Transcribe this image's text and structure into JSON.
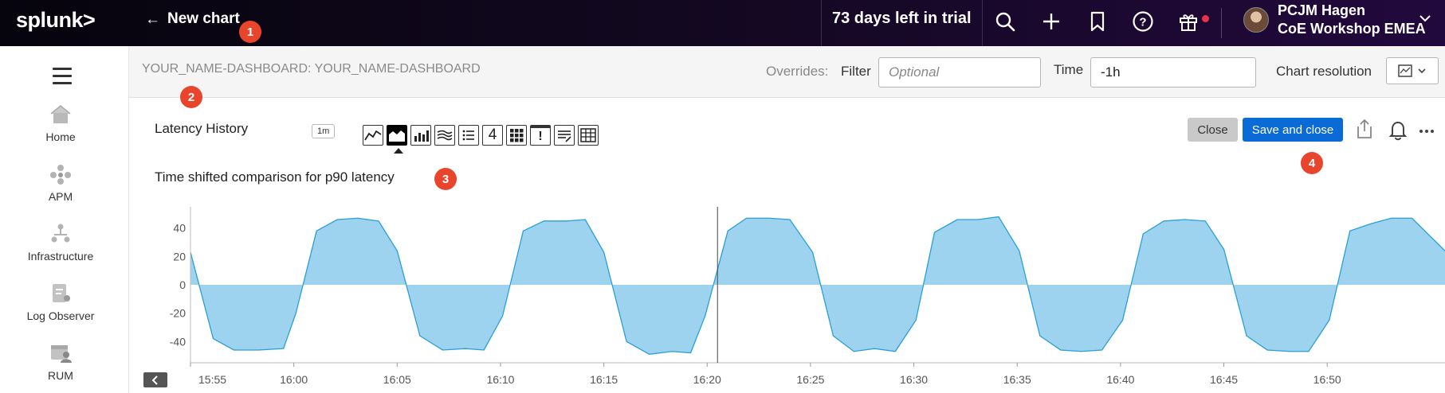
{
  "topbar": {
    "logo": "splunk>",
    "back_arrow": "←",
    "title": "New chart",
    "trial_text": "73 days left in trial",
    "icons": [
      "search-icon",
      "plus-icon",
      "bookmark-icon",
      "help-icon",
      "gift-icon"
    ],
    "user_name": "PCJM Hagen",
    "org_name": "CoE Workshop EMEA"
  },
  "sidebar": {
    "items": [
      {
        "label": "Home",
        "icon": "home-icon"
      },
      {
        "label": "APM",
        "icon": "apm-icon"
      },
      {
        "label": "Infrastructure",
        "icon": "infrastructure-icon"
      },
      {
        "label": "Log Observer",
        "icon": "log-observer-icon"
      },
      {
        "label": "RUM",
        "icon": "rum-icon"
      }
    ]
  },
  "header": {
    "breadcrumb": "YOUR_NAME-DASHBOARD: YOUR_NAME-DASHBOARD",
    "overrides_label": "Overrides:",
    "filter_label": "Filter",
    "filter_placeholder": "Optional",
    "time_label": "Time",
    "time_value": "-1h",
    "resolution_label": "Chart resolution"
  },
  "chart_header": {
    "title": "Latency History",
    "resolution_badge": "1m",
    "viz_types": [
      "line-chart-icon",
      "area-chart-icon",
      "column-chart-icon",
      "histogram-icon",
      "list-icon",
      "single-value-icon",
      "heatmap-icon",
      "event-feed-icon",
      "text-note-icon",
      "table-icon"
    ],
    "single_value_glyph": "4",
    "event_glyph": "!",
    "close_label": "Close",
    "save_label": "Save and close",
    "subtitle": "Time shifted comparison  for p90 latency"
  },
  "markers": [
    "1",
    "2",
    "3",
    "4"
  ],
  "colors": {
    "accent_blue": "#0a6ad6",
    "area_fill": "#9dd3ef",
    "area_stroke": "#2a9fd6",
    "marker_red": "#e8452c"
  },
  "chart_data": {
    "type": "area",
    "title": "",
    "xlabel": "",
    "ylabel": "",
    "ylim": [
      -55,
      55
    ],
    "y_ticks": [
      40,
      20,
      0,
      -20,
      -40
    ],
    "x_tick_labels": [
      "15:55",
      "16:00",
      "16:05",
      "16:10",
      "16:15",
      "16:20",
      "16:25",
      "16:30",
      "16:35",
      "16:40",
      "16:45",
      "16:50"
    ],
    "x_start_minute": 55,
    "x_end_minute": 115.7,
    "cursor_minute": 80.5,
    "grid": false,
    "series": [
      {
        "points": [
          [
            55.0,
            23
          ],
          [
            56.1,
            -38
          ],
          [
            57.1,
            -46
          ],
          [
            58.3,
            -46
          ],
          [
            59.5,
            -45
          ],
          [
            60.1,
            -20
          ],
          [
            61.1,
            38
          ],
          [
            62.1,
            46
          ],
          [
            63.1,
            47
          ],
          [
            64.1,
            45
          ],
          [
            65.0,
            24
          ],
          [
            66.1,
            -36
          ],
          [
            67.2,
            -46
          ],
          [
            68.3,
            -45
          ],
          [
            69.2,
            -46
          ],
          [
            70.1,
            -22
          ],
          [
            71.1,
            38
          ],
          [
            72.1,
            45
          ],
          [
            73.2,
            45
          ],
          [
            74.1,
            46
          ],
          [
            75.0,
            23
          ],
          [
            76.1,
            -40
          ],
          [
            77.2,
            -49
          ],
          [
            78.3,
            -47
          ],
          [
            79.2,
            -48
          ],
          [
            79.9,
            -22
          ],
          [
            81.0,
            38
          ],
          [
            81.9,
            47
          ],
          [
            83.0,
            47
          ],
          [
            84.0,
            46
          ],
          [
            85.1,
            23
          ],
          [
            86.1,
            -36
          ],
          [
            87.1,
            -47
          ],
          [
            88.1,
            -45
          ],
          [
            89.1,
            -47
          ],
          [
            90.1,
            -25
          ],
          [
            91.0,
            37
          ],
          [
            92.1,
            46
          ],
          [
            93.1,
            46
          ],
          [
            94.1,
            48
          ],
          [
            95.1,
            24
          ],
          [
            96.1,
            -36
          ],
          [
            97.1,
            -46
          ],
          [
            98.1,
            -47
          ],
          [
            99.1,
            -46
          ],
          [
            100.1,
            -25
          ],
          [
            101.1,
            36
          ],
          [
            102.1,
            45
          ],
          [
            103.1,
            46
          ],
          [
            104.1,
            45
          ],
          [
            105.0,
            25
          ],
          [
            106.1,
            -36
          ],
          [
            107.1,
            -46
          ],
          [
            108.2,
            -47
          ],
          [
            109.1,
            -47
          ],
          [
            110.1,
            -25
          ],
          [
            111.1,
            38
          ],
          [
            112.1,
            43
          ],
          [
            113.1,
            47
          ],
          [
            114.1,
            47
          ],
          [
            115.7,
            24
          ]
        ]
      }
    ]
  }
}
